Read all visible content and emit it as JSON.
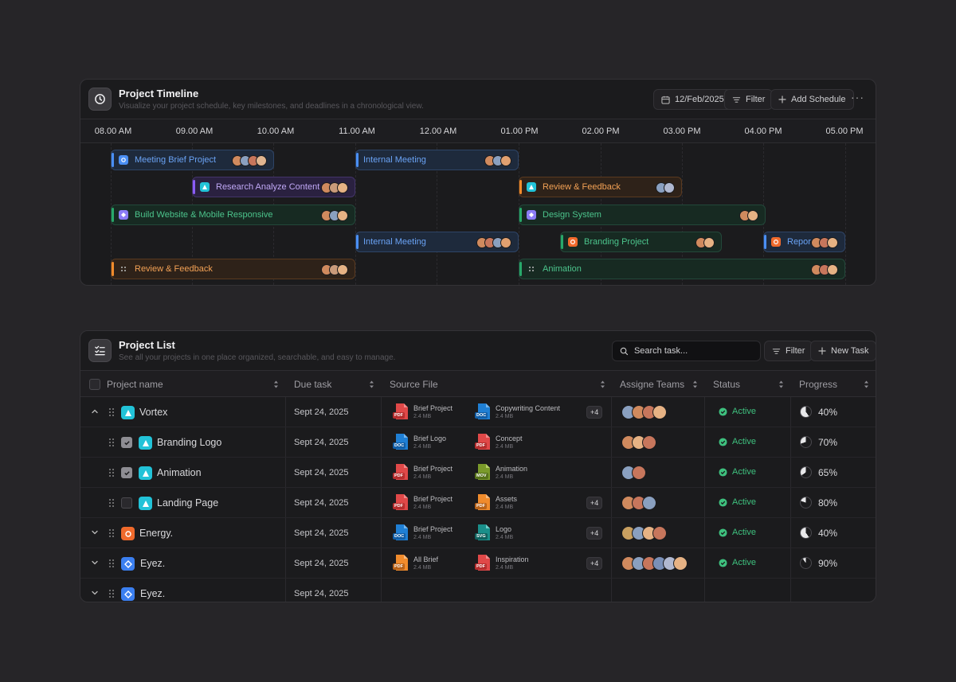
{
  "timeline": {
    "title": "Project Timeline",
    "subtitle": "Visualize your project schedule, key milestones, and deadlines in a chronological view.",
    "date": "12/Feb/2025",
    "filter_label": "Filter",
    "add_label": "Add Schedule",
    "more_label": "···",
    "hours": [
      "08.00 AM",
      "09.00 AM",
      "10.00 AM",
      "11.00 AM",
      "12.00 AM",
      "01.00 PM",
      "02.00 PM",
      "03.00 PM",
      "04.00 PM",
      "05.00 PM"
    ],
    "events": [
      {
        "label": "Meeting Brief Project",
        "color": "blue",
        "icon": "meeting-icon",
        "avatars": 4
      },
      {
        "label": "Internal Meeting",
        "color": "blue",
        "icon": "",
        "avatars": 3
      },
      {
        "label": "Research Analyze Content",
        "color": "purple",
        "icon": "research-icon",
        "avatars": 3
      },
      {
        "label": "Review & Feedback",
        "color": "orange",
        "icon": "review-icon",
        "avatars": 2
      },
      {
        "label": "Build Website & Mobile Responsive",
        "color": "green",
        "icon": "build-icon",
        "avatars": 3
      },
      {
        "label": "Design System",
        "color": "green",
        "icon": "design-icon",
        "avatars": 2
      },
      {
        "label": "Internal Meeting",
        "color": "blue",
        "icon": "",
        "avatars": 4
      },
      {
        "label": "Branding Project",
        "color": "green",
        "icon": "branding-icon",
        "avatars": 2
      },
      {
        "label": "Repor...",
        "color": "blue",
        "icon": "report-icon",
        "avatars": 3
      },
      {
        "label": "Review & Feedback",
        "color": "orange",
        "icon": "grid-icon",
        "avatars": 3
      },
      {
        "label": "Animation",
        "color": "green",
        "icon": "grid-icon",
        "avatars": 3
      }
    ]
  },
  "list": {
    "title": "Project List",
    "subtitle": "See all your projects in one place organized, searchable, and easy to manage.",
    "search_placeholder": "Search task...",
    "filter_label": "Filter",
    "new_task_label": "New Task",
    "columns": [
      "Project name",
      "Due task",
      "Source File",
      "Assigne Teams",
      "Status",
      "Progress"
    ],
    "rows": [
      {
        "name": "Vortex",
        "due": "Sept 24, 2025",
        "files": [
          {
            "name": "Brief Project",
            "size": "2.4 MB",
            "type": "PDF"
          },
          {
            "name": "Copywriting Content",
            "size": "2.4 MB",
            "type": "DOC"
          }
        ],
        "extra": "+4",
        "team": 4,
        "status": "Active",
        "progress": "40%",
        "progress_value": 40
      },
      {
        "name": "Branding Logo",
        "due": "Sept 24, 2025",
        "files": [
          {
            "name": "Brief Logo",
            "size": "2.4 MB",
            "type": "DOC"
          },
          {
            "name": "Concept",
            "size": "2.4 MB",
            "type": "PDF"
          }
        ],
        "extra": "",
        "team": 3,
        "status": "Active",
        "progress": "70%",
        "progress_value": 70
      },
      {
        "name": "Animation",
        "due": "Sept 24, 2025",
        "files": [
          {
            "name": "Brief Project",
            "size": "2.4 MB",
            "type": "PDF"
          },
          {
            "name": "Animation",
            "size": "2.4 MB",
            "type": "MOV"
          }
        ],
        "extra": "",
        "team": 2,
        "status": "Active",
        "progress": "65%",
        "progress_value": 65
      },
      {
        "name": "Landing Page",
        "due": "Sept 24, 2025",
        "files": [
          {
            "name": "Brief Project",
            "size": "2.4 MB",
            "type": "PDF"
          },
          {
            "name": "Assets",
            "size": "2.4 MB",
            "type": "PDF"
          }
        ],
        "extra": "+4",
        "team": 3,
        "status": "Active",
        "progress": "80%",
        "progress_value": 80
      },
      {
        "name": "Energy.",
        "due": "Sept 24, 2025",
        "files": [
          {
            "name": "Brief Project",
            "size": "2.4 MB",
            "type": "DOC"
          },
          {
            "name": "Logo",
            "size": "2.4 MB",
            "type": "SVG"
          }
        ],
        "extra": "+4",
        "team": 4,
        "status": "Active",
        "progress": "40%",
        "progress_value": 40
      },
      {
        "name": "Eyez.",
        "due": "Sept 24, 2025",
        "files": [
          {
            "name": "All Brief",
            "size": "2.4 MB",
            "type": "PDF"
          },
          {
            "name": "Inspiration",
            "size": "2.4 MB",
            "type": "PDF"
          }
        ],
        "extra": "+4",
        "team": 6,
        "status": "Active",
        "progress": "90%",
        "progress_value": 90
      },
      {
        "name": "Eyez.",
        "due": "Sept 24, 2025"
      }
    ]
  },
  "colors": {
    "blue": "#4a8ff5",
    "purple": "#8b5cf6",
    "green": "#28a86a",
    "orange": "#f08b2c",
    "active": "#3ec07e"
  }
}
